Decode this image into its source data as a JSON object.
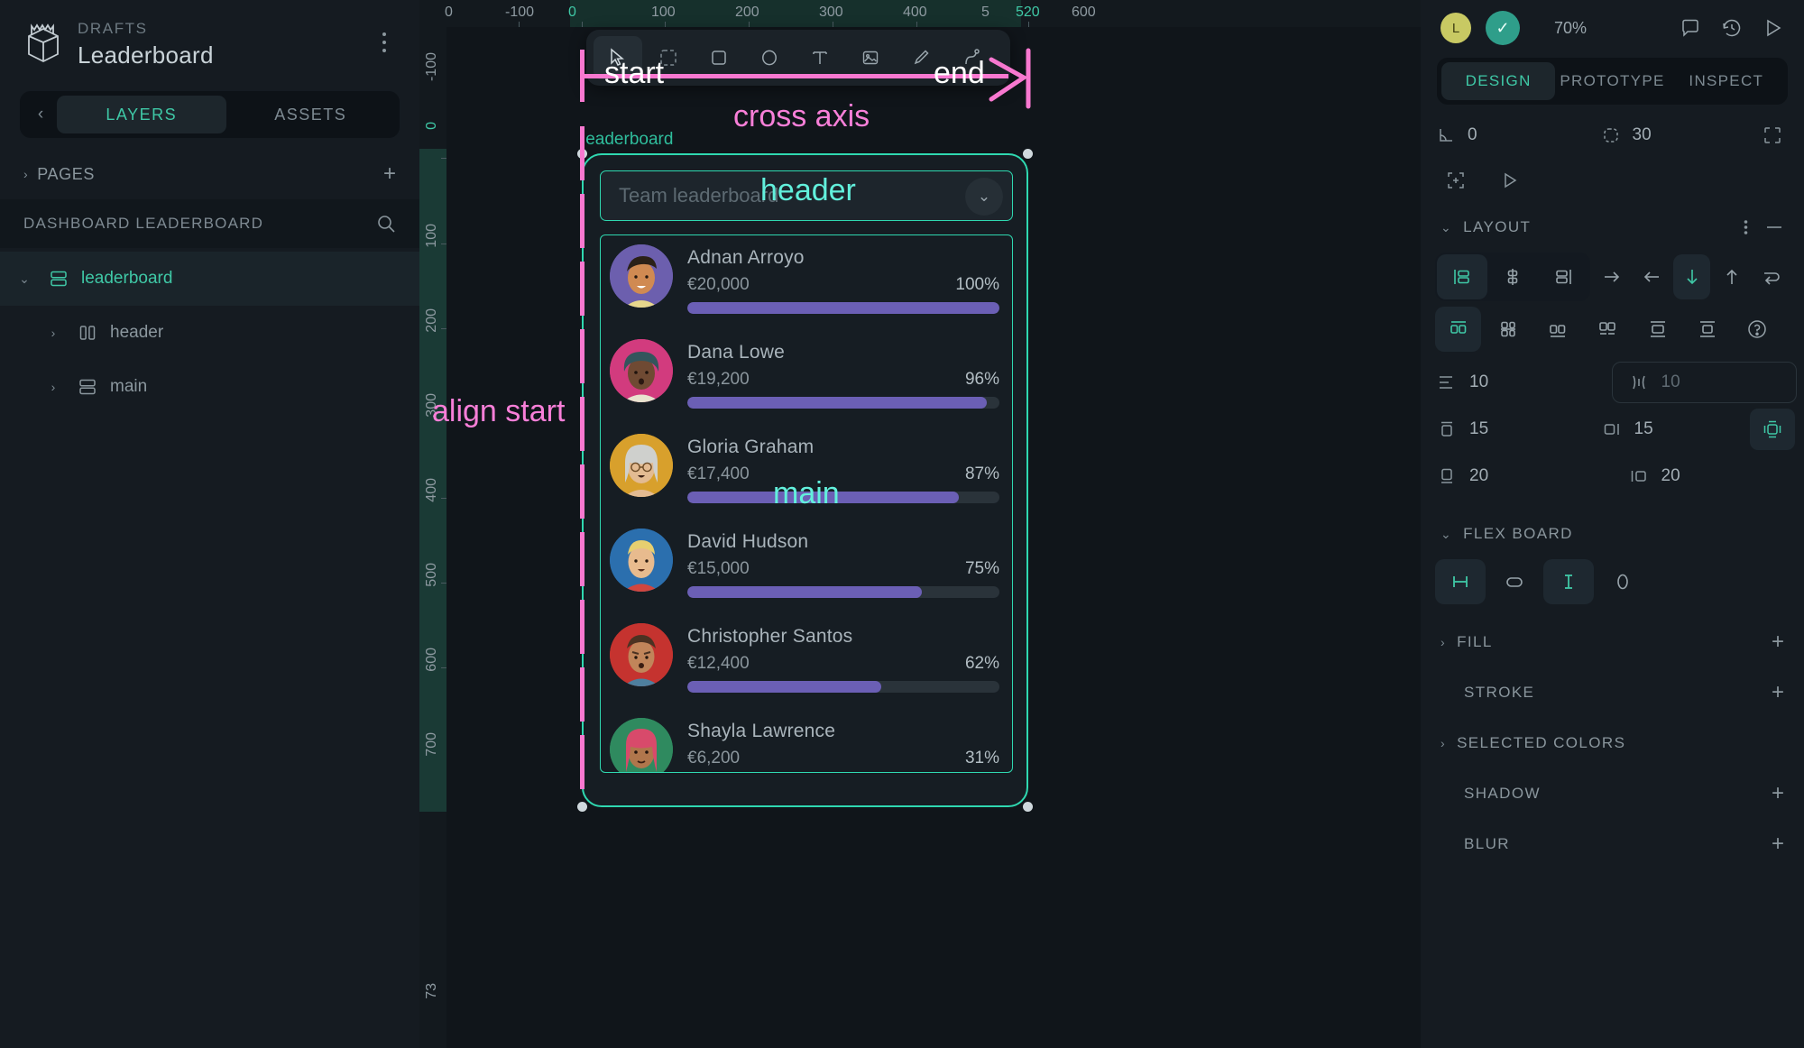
{
  "left": {
    "drafts_label": "DRAFTS",
    "file_name": "Leaderboard",
    "tabs": [
      {
        "label": "LAYERS",
        "active": true
      },
      {
        "label": "ASSETS",
        "active": false
      }
    ],
    "pages_label": "PAGES",
    "page_name": "DASHBOARD LEADERBOARD",
    "layers": [
      {
        "label": "leaderboard",
        "selected": true,
        "indent": false,
        "twisty": "⌄",
        "icon": "frame-icon"
      },
      {
        "label": "header",
        "selected": false,
        "indent": true,
        "twisty": "›",
        "icon": "columns-icon"
      },
      {
        "label": "main",
        "selected": false,
        "indent": true,
        "twisty": "›",
        "icon": "frame-icon"
      }
    ]
  },
  "canvas": {
    "ruler_h": [
      "0",
      "-100",
      "0",
      "100",
      "200",
      "300",
      "400",
      "5",
      "520",
      "600"
    ],
    "ruler_v": [
      "-100",
      "0",
      "100",
      "200",
      "300",
      "400",
      "500",
      "600",
      "700",
      "73"
    ],
    "board_label": "leaderboard",
    "toolbar": [
      {
        "name": "cursor-icon",
        "active": true
      },
      {
        "name": "scale-icon",
        "active": false
      },
      {
        "name": "rectangle-icon",
        "active": false
      },
      {
        "name": "ellipse-icon",
        "active": false
      },
      {
        "name": "text-icon",
        "active": false
      },
      {
        "name": "image-icon",
        "active": false
      },
      {
        "name": "pen-icon",
        "active": false
      },
      {
        "name": "curve-icon",
        "active": false
      }
    ],
    "header_placeholder": "Team leaderboard",
    "annotations": {
      "start": "start",
      "end": "end",
      "cross_axis": "cross axis",
      "align_start": "align start",
      "header": "header",
      "main": "main"
    },
    "leaderboard": [
      {
        "name": "Adnan Arroyo",
        "amount": "€20,000",
        "pct": "100%",
        "value": 100,
        "av_bg": "#6c5fae",
        "hair": "#2b2118",
        "skin": "#d08a52",
        "shirt": "#e7d78c"
      },
      {
        "name": "Dana Lowe",
        "amount": "€19,200",
        "pct": "96%",
        "value": 96,
        "av_bg": "#d23b7e",
        "hair": "#33555c",
        "skin": "#6f4a33",
        "shirt": "#e8e3cf"
      },
      {
        "name": "Gloria Graham",
        "amount": "€17,400",
        "pct": "87%",
        "value": 87,
        "av_bg": "#d8a02c",
        "hair": "#cfd0cd",
        "skin": "#e3bb92",
        "shirt": "#e3bb92"
      },
      {
        "name": "David Hudson",
        "amount": "€15,000",
        "pct": "75%",
        "value": 75,
        "av_bg": "#2b6fae",
        "hair": "#e7cf70",
        "skin": "#e8bb8e",
        "shirt": "#d1463f"
      },
      {
        "name": "Christopher Santos",
        "amount": "€12,400",
        "pct": "62%",
        "value": 62,
        "av_bg": "#c5332f",
        "hair": "#4b3222",
        "skin": "#c1855a",
        "shirt": "#4e7f9e"
      },
      {
        "name": "Shayla Lawrence",
        "amount": "€6,200",
        "pct": "31%",
        "value": 31,
        "av_bg": "#2f8a5f",
        "hair": "#d84a6b",
        "skin": "#b0764c",
        "shirt": "#dde0e2"
      }
    ]
  },
  "right": {
    "avatar_initial": "L",
    "zoom": "70%",
    "tabs": [
      {
        "label": "DESIGN",
        "active": true
      },
      {
        "label": "PROTOTYPE",
        "active": false
      },
      {
        "label": "INSPECT",
        "active": false
      }
    ],
    "rotation": "0",
    "corner_radius": "30",
    "layout": {
      "title": "LAYOUT",
      "gap": "10",
      "gap_secondary": "10",
      "pad_top": "15",
      "pad_right": "15",
      "pad_bottom": "20",
      "pad_left": "20"
    },
    "flex_board": {
      "title": "FLEX BOARD",
      "zero_label": "0"
    },
    "sections": [
      {
        "title": "FILL",
        "caret": true,
        "plus": true
      },
      {
        "title": "STROKE",
        "caret": false,
        "plus": true
      },
      {
        "title": "SELECTED COLORS",
        "caret": true,
        "plus": false
      },
      {
        "title": "SHADOW",
        "caret": false,
        "plus": true
      },
      {
        "title": "BLUR",
        "caret": false,
        "plus": true
      }
    ]
  },
  "colors": {
    "accent_teal": "#3fc8a6",
    "annotation_pink": "#f878d0",
    "annotation_cyan": "#62f0dc",
    "progress": "#6b5fb5"
  }
}
